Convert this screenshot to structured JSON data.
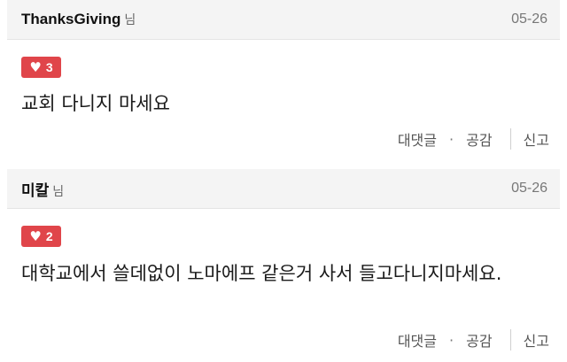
{
  "comments": [
    {
      "author": "ThanksGiving",
      "suffix": "님",
      "date": "05-26",
      "likes": "3",
      "body": "교회 다니지 마세요",
      "actions": {
        "reply": "대댓글",
        "dot": "·",
        "empathy": "공감",
        "report": "신고"
      }
    },
    {
      "author": "미칼",
      "suffix": "님",
      "date": "05-26",
      "likes": "2",
      "body": "대학교에서 쓸데없이 노마에프 같은거 사서 들고다니지마세요.",
      "actions": {
        "reply": "대댓글",
        "dot": "·",
        "empathy": "공감",
        "report": "신고"
      }
    }
  ],
  "colors": {
    "like_badge": "#e0454a",
    "header_bg": "#f4f4f4"
  },
  "icons": {
    "like": "heart-icon"
  }
}
